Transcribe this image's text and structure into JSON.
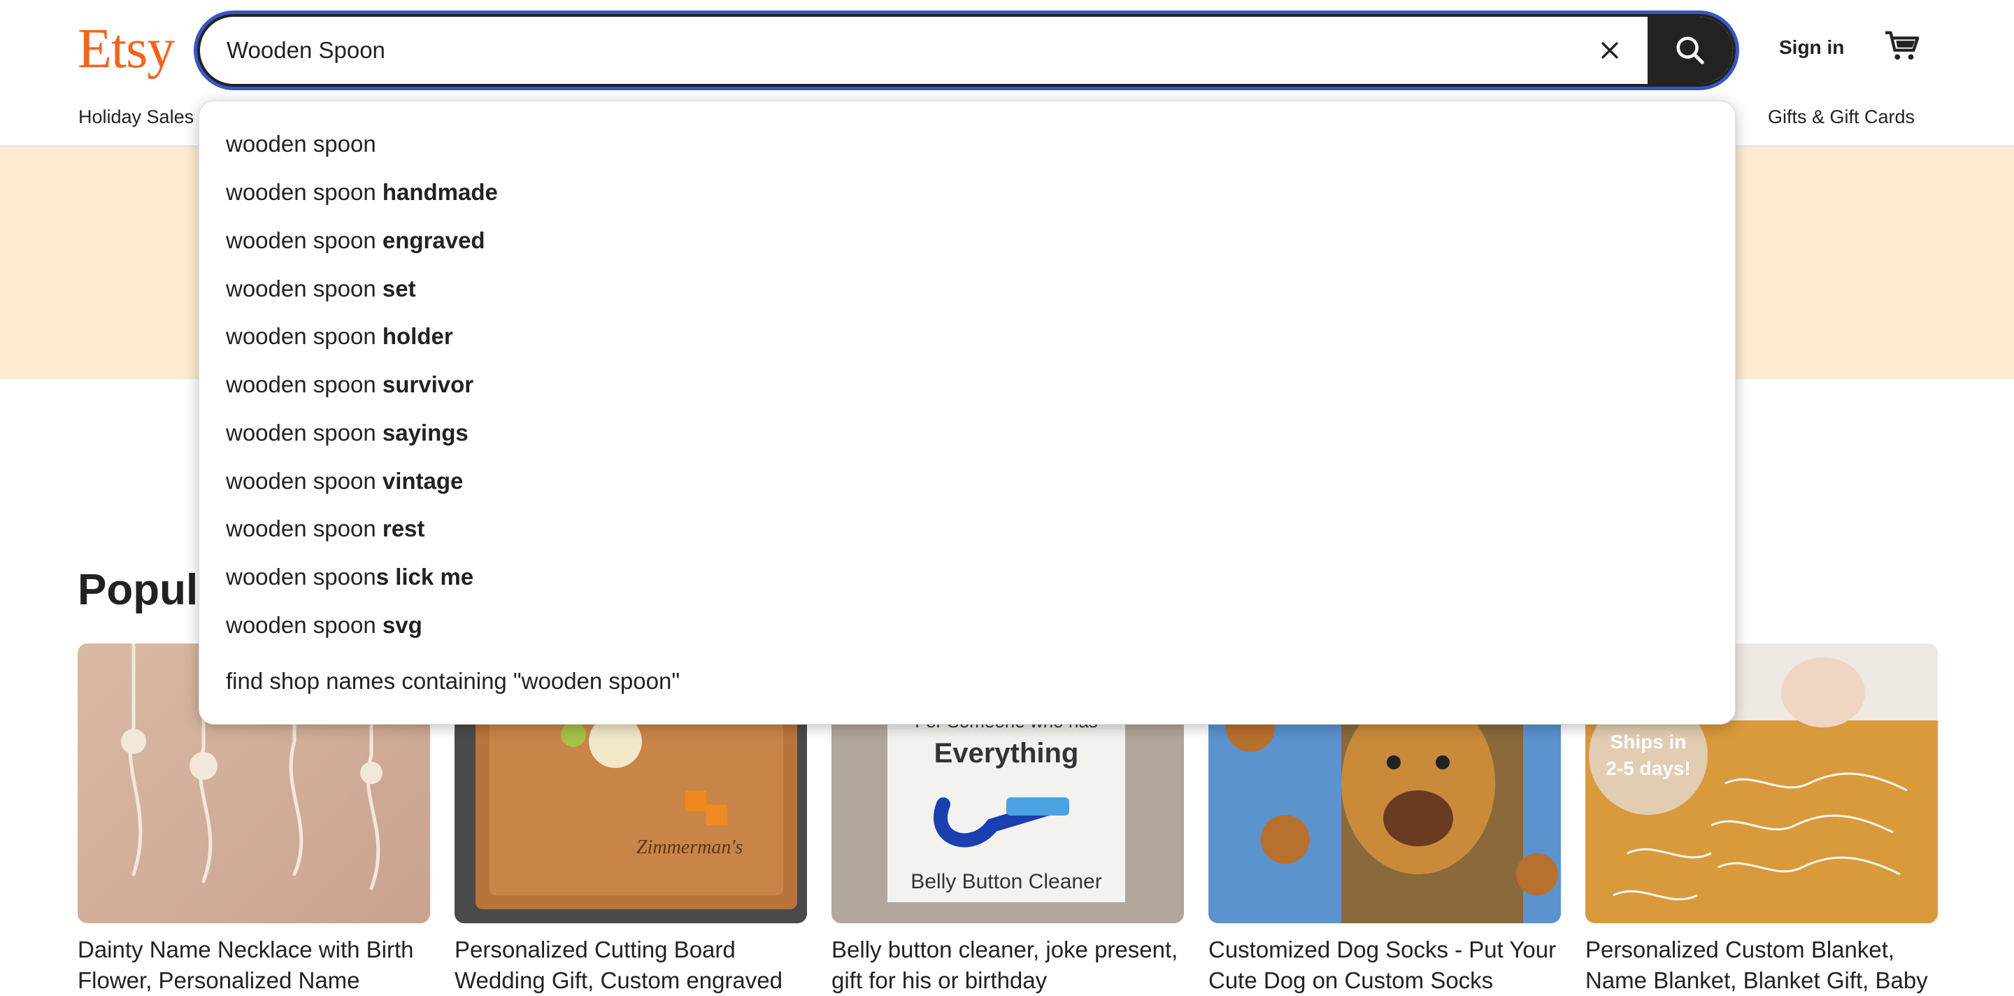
{
  "header": {
    "logo": "Etsy",
    "search_value": "Wooden Spoon",
    "sign_in": "Sign in"
  },
  "nav": {
    "left": "Holiday Sales",
    "right": "Gifts & Gift Cards"
  },
  "section": {
    "title": "Popular gifts right now"
  },
  "suggestions": [
    {
      "prefix": "wooden spoon",
      "suffix": ""
    },
    {
      "prefix": "wooden spoon ",
      "suffix": "handmade"
    },
    {
      "prefix": "wooden spoon ",
      "suffix": "engraved"
    },
    {
      "prefix": "wooden spoon ",
      "suffix": "set"
    },
    {
      "prefix": "wooden spoon ",
      "suffix": "holder"
    },
    {
      "prefix": "wooden spoon ",
      "suffix": "survivor"
    },
    {
      "prefix": "wooden spoon ",
      "suffix": "sayings"
    },
    {
      "prefix": "wooden spoon ",
      "suffix": "vintage"
    },
    {
      "prefix": "wooden spoon ",
      "suffix": "rest"
    },
    {
      "prefix": "wooden spoon",
      "suffix": "s lick me"
    },
    {
      "prefix": "wooden spoon ",
      "suffix": "svg"
    }
  ],
  "shop_search": "find shop names containing \"wooden spoon\"",
  "products": [
    {
      "title": "Dainty Name Necklace with Birth Flower, Personalized Name Necklace"
    },
    {
      "title": "Personalized Cutting Board Wedding Gift, Custom engraved"
    },
    {
      "title": "Belly button cleaner, joke present, gift for his or birthday"
    },
    {
      "title": "Customized Dog Socks - Put Your Cute Dog on Custom Socks"
    },
    {
      "title": "Personalized Custom Blanket, Name Blanket, Blanket Gift, Baby"
    }
  ],
  "product_image_text": {
    "card3_line1": "For Someone who has",
    "card3_line2": "Everything",
    "card3_line3": "Belly Button Cleaner",
    "card5_badge_line1": "Ships in",
    "card5_badge_line2": "2-5 days!"
  },
  "colors": {
    "brand": "#F1641E",
    "banner": "#FDEBD2",
    "focus_ring": "#3b55c6"
  }
}
